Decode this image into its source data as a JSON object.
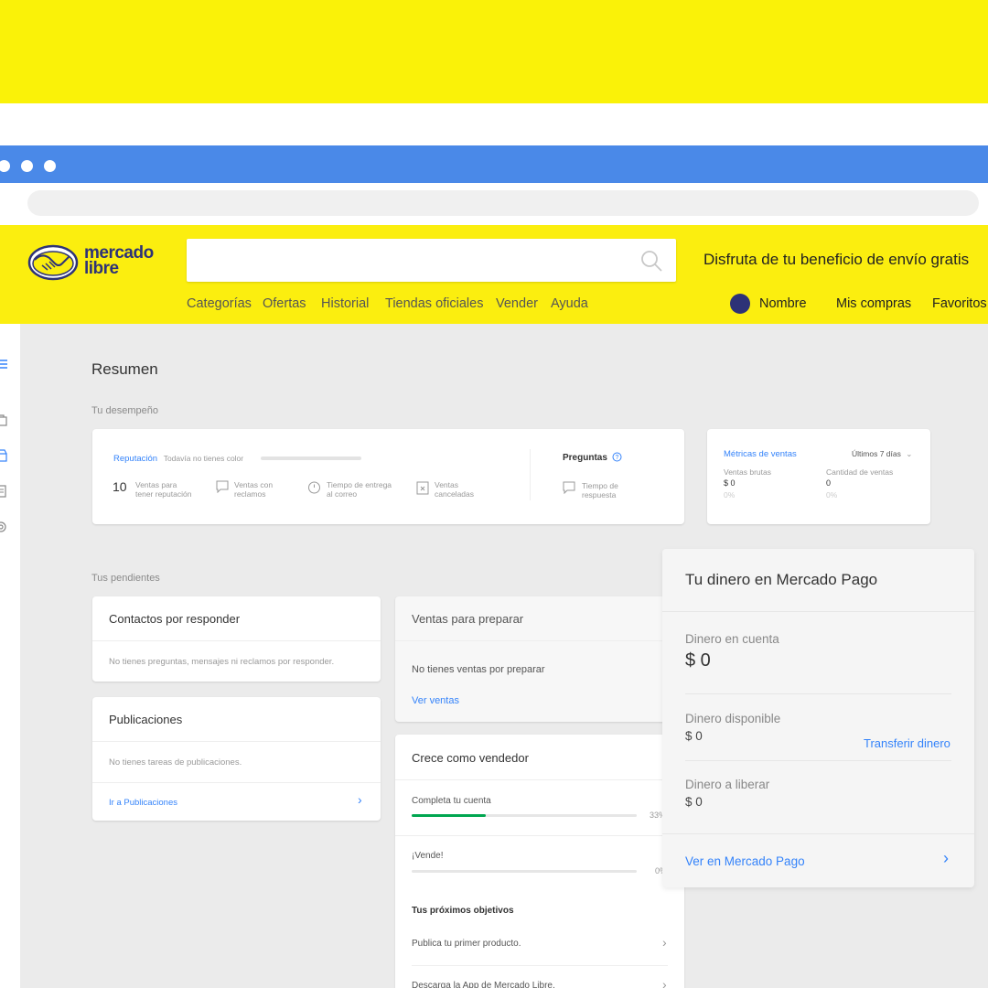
{
  "header": {
    "logo_line1": "mercado",
    "logo_line2": "libre",
    "promo": "Disfruta de tu beneficio de envío gratis",
    "nav": [
      "Categorías",
      "Ofertas",
      "Historial",
      "Tiendas oficiales",
      "Vender",
      "Ayuda"
    ],
    "user_name": "Nombre",
    "my_purchases": "Mis compras",
    "favorites": "Favoritos"
  },
  "page": {
    "title": "Resumen",
    "performance_label": "Tu desempeño",
    "pending_label": "Tus pendientes"
  },
  "reputation": {
    "title": "Reputación",
    "subtitle": "Todavía no tienes color",
    "count": "10",
    "count_text_1": "Ventas para",
    "count_text_2": "tener reputación",
    "claims_1": "Ventas con",
    "claims_2": "reclamos",
    "delivery_1": "Tiempo de entrega",
    "delivery_2": "al correo",
    "cancel_1": "Ventas",
    "cancel_2": "canceladas",
    "questions_title": "Preguntas",
    "response_1": "Tiempo de",
    "response_2": "respuesta"
  },
  "metrics": {
    "title": "Métricas de ventas",
    "period": "Últimos 7 días",
    "gross_label": "Ventas brutas",
    "gross_value": "$ 0",
    "gross_pct": "0%",
    "qty_label": "Cantidad de ventas",
    "qty_value": "0",
    "qty_pct": "0%"
  },
  "contacts": {
    "title": "Contactos por responder",
    "empty": "No tienes preguntas, mensajes ni reclamos por responder."
  },
  "publications": {
    "title": "Publicaciones",
    "empty": "No tienes tareas de publicaciones.",
    "link": "Ir a Publicaciones"
  },
  "sales_prep": {
    "title": "Ventas para preparar",
    "empty": "No tienes ventas por preparar",
    "link": "Ver ventas"
  },
  "grow": {
    "title": "Crece como vendedor",
    "step1_label": "Completa tu cuenta",
    "step1_pct": "33%",
    "step1_progress": 0.33,
    "step2_label": "¡Vende!",
    "step2_pct": "0%",
    "step2_progress": 0,
    "next_goals": "Tus próximos objetivos",
    "goal1": "Publica tu primer producto.",
    "goal2": "Descarga la App de Mercado Libre."
  },
  "money": {
    "title": "Tu dinero en Mercado Pago",
    "account_label": "Dinero en cuenta",
    "account_value": "$ 0",
    "available_label": "Dinero disponible",
    "available_value": "$ 0",
    "transfer": "Transferir dinero",
    "release_label": "Dinero a liberar",
    "release_value": "$ 0",
    "view_link": "Ver en Mercado Pago"
  },
  "colors": {
    "brand_yellow": "#fbee0f",
    "brand_blue": "#3483fa",
    "browser_blue": "#4a89e8",
    "progress_green": "#00a650"
  }
}
